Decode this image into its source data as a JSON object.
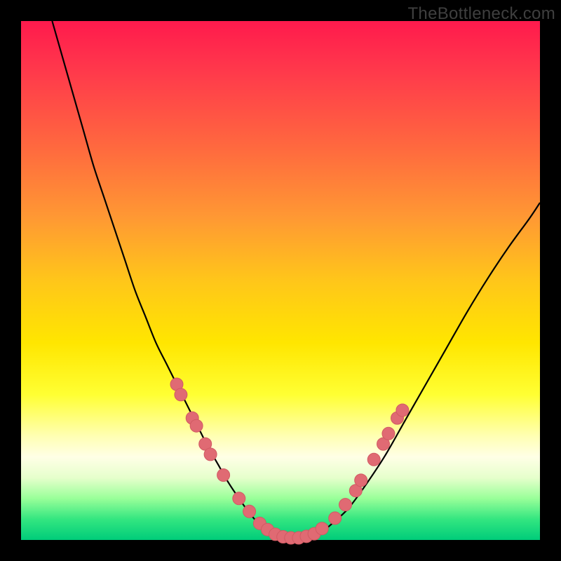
{
  "watermark": "TheBottleneck.com",
  "colors": {
    "frame": "#000000",
    "curve_stroke": "#000000",
    "marker_fill": "#e06a73",
    "marker_stroke": "#d15a63"
  },
  "chart_data": {
    "type": "line",
    "title": "",
    "xlabel": "",
    "ylabel": "",
    "xlim": [
      0,
      100
    ],
    "ylim": [
      0,
      100
    ],
    "grid": false,
    "legend": false,
    "note": "No axes, ticks, or labels are rendered in the image; values are relative 0–100 estimates from pixel position.",
    "series": [
      {
        "name": "curve",
        "x": [
          6,
          8,
          10,
          12,
          14,
          16,
          18,
          20,
          22,
          24,
          26,
          28,
          30,
          32,
          34,
          36,
          38,
          40,
          42,
          44,
          46,
          48,
          50,
          52,
          54,
          56,
          58,
          60,
          63,
          66,
          70,
          74,
          78,
          82,
          86,
          90,
          94,
          98,
          100
        ],
        "y": [
          100,
          93,
          86,
          79,
          72,
          66,
          60,
          54,
          48,
          43,
          38,
          34,
          30,
          26,
          22,
          18,
          14.5,
          11,
          8,
          5.2,
          3,
          1.6,
          0.8,
          0.4,
          0.4,
          0.8,
          1.6,
          3.2,
          6,
          10,
          16,
          23,
          30,
          37,
          44,
          50.5,
          56.5,
          62,
          65
        ]
      }
    ],
    "markers": [
      {
        "x": 30.0,
        "y": 30.0
      },
      {
        "x": 30.8,
        "y": 28.0
      },
      {
        "x": 33.0,
        "y": 23.5
      },
      {
        "x": 33.8,
        "y": 22.0
      },
      {
        "x": 35.5,
        "y": 18.5
      },
      {
        "x": 36.5,
        "y": 16.5
      },
      {
        "x": 39.0,
        "y": 12.5
      },
      {
        "x": 42.0,
        "y": 8.0
      },
      {
        "x": 44.0,
        "y": 5.5
      },
      {
        "x": 46.0,
        "y": 3.2
      },
      {
        "x": 47.5,
        "y": 2.0
      },
      {
        "x": 49.0,
        "y": 1.1
      },
      {
        "x": 50.5,
        "y": 0.6
      },
      {
        "x": 52.0,
        "y": 0.4
      },
      {
        "x": 53.5,
        "y": 0.4
      },
      {
        "x": 55.0,
        "y": 0.7
      },
      {
        "x": 56.5,
        "y": 1.2
      },
      {
        "x": 58.0,
        "y": 2.2
      },
      {
        "x": 60.5,
        "y": 4.2
      },
      {
        "x": 62.5,
        "y": 6.8
      },
      {
        "x": 64.5,
        "y": 9.5
      },
      {
        "x": 65.5,
        "y": 11.5
      },
      {
        "x": 68.0,
        "y": 15.5
      },
      {
        "x": 69.8,
        "y": 18.5
      },
      {
        "x": 70.8,
        "y": 20.5
      },
      {
        "x": 72.5,
        "y": 23.5
      },
      {
        "x": 73.5,
        "y": 25.0
      }
    ]
  }
}
